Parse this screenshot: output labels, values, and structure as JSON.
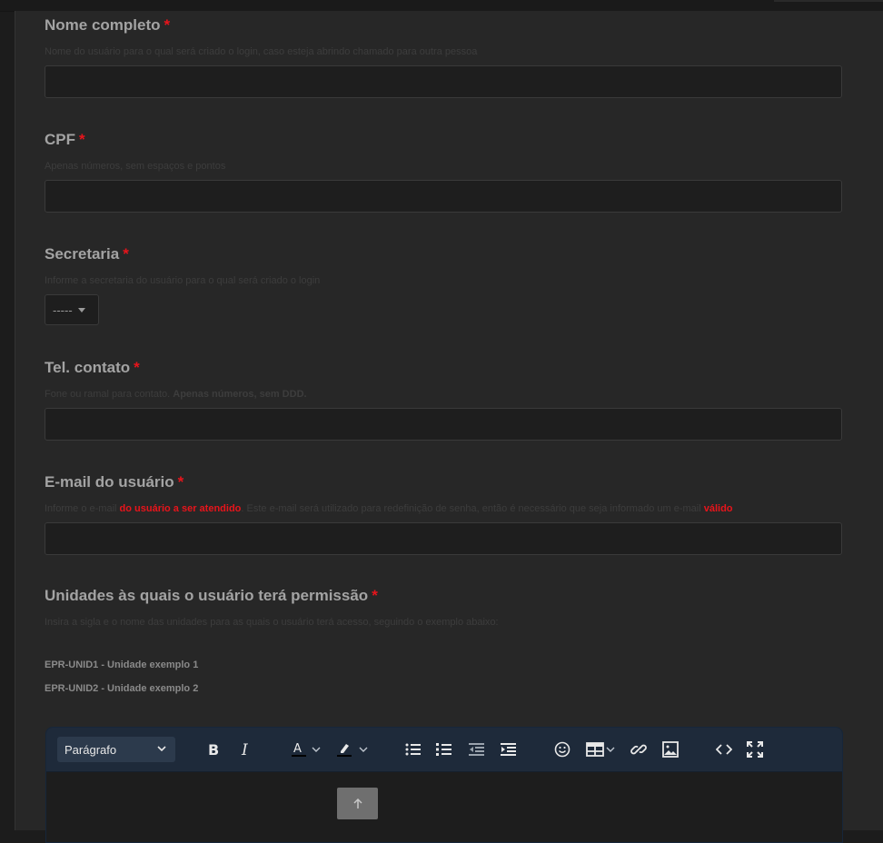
{
  "form": {
    "fields": [
      {
        "label": "Nome completo",
        "required": "*",
        "help": "Nome do usuário para o qual será criado o login, caso esteja abrindo chamado para outra pessoa"
      },
      {
        "label": "CPF",
        "required": "*",
        "help": "Apenas números, sem espaços e pontos"
      },
      {
        "label": "Secretaria",
        "required": "*",
        "help": "Informe a secretaria do usuário para o qual será criado o login",
        "select_value": "-----"
      },
      {
        "label": "Tel. contato",
        "required": "*",
        "help_prefix": "Fone ou ramal para contato. ",
        "help_bold": "Apenas números, sem DDD."
      },
      {
        "label": "E-mail do usuário",
        "required": "*",
        "help_1": "Informe o e-mail ",
        "help_hl_1": "do usuário a ser atendido",
        "help_2": ". Este e-mail será utilizado para redefinição de senha, então é necessário que seja informado um e-mail ",
        "help_hl_2": "válido"
      },
      {
        "label": "Unidades às quais o usuário terá permissão",
        "required": "*",
        "help": "Insira a sigla e o nome das unidades para as quais o usuário terá acesso, seguindo o exemplo abaixo:"
      }
    ],
    "examples": [
      "EPR-UNID1 - Unidade exemplo 1",
      "EPR-UNID2 - Unidade exemplo 2"
    ]
  },
  "editor": {
    "block_format": "Parágrafo",
    "tools": [
      "bold-icon",
      "italic-icon",
      "text-color-icon",
      "highlight-icon",
      "bullet-list-icon",
      "numbered-list-icon",
      "outdent-icon",
      "indent-icon",
      "emoji-icon",
      "table-icon",
      "link-icon",
      "image-icon",
      "code-icon",
      "fullscreen-icon"
    ]
  },
  "colors": {
    "required": "#e8141b",
    "toolbar": "#1e2a3a",
    "panel": "#272727"
  }
}
